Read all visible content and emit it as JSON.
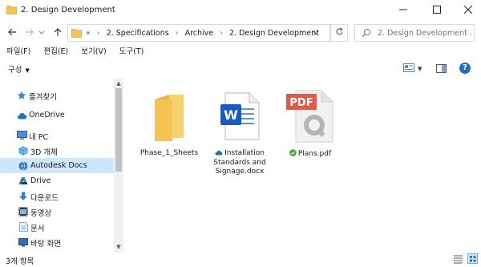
{
  "window": {
    "title": "2. Design Development",
    "minimize_icon": "minimize-icon",
    "maximize_icon": "maximize-icon",
    "close_icon": "close-icon"
  },
  "address": {
    "crumbs": [
      "2. Specifications",
      "Archive",
      "2. Design Development"
    ],
    "overflow": "«",
    "separator": "›",
    "search_placeholder": "2. Design Development ..."
  },
  "menu": [
    "파일(F)",
    "편집(E)",
    "보기(V)",
    "도구(T)"
  ],
  "command": {
    "organize": "구성",
    "help": "?"
  },
  "sidebar": {
    "items": [
      {
        "label": "즐겨찾기",
        "icon": "star-icon"
      },
      {
        "label": "OneDrive",
        "icon": "cloud-icon"
      },
      {
        "label": "내 PC",
        "icon": "pc-icon"
      },
      {
        "label": "3D 개체",
        "icon": "3d-objects-icon"
      },
      {
        "label": "Autodesk Docs",
        "icon": "autodesk-docs-icon"
      },
      {
        "label": "Drive",
        "icon": "drive-icon"
      },
      {
        "label": "다운로드",
        "icon": "download-icon"
      },
      {
        "label": "동영상",
        "icon": "video-icon"
      },
      {
        "label": "문서",
        "icon": "document-icon"
      },
      {
        "label": "바탕 화면",
        "icon": "desktop-icon"
      }
    ],
    "selected": "Autodesk Docs"
  },
  "files": [
    {
      "name": "Phase_1_Sheets",
      "type": "folder",
      "status": ""
    },
    {
      "name": "Installation Standards and Signage.docx",
      "type": "word",
      "status": "cloud-icon"
    },
    {
      "name": "Plans.pdf",
      "type": "pdf",
      "status": "synced-check-icon"
    }
  ],
  "status": {
    "count": "3개 항목"
  },
  "colors": {
    "accent": "#1f6fbf",
    "selection": "#cce8ff",
    "folder": "#f3c454",
    "word": "#185abd",
    "pdf": "#e05a4c",
    "synced": "#3fa33f"
  }
}
